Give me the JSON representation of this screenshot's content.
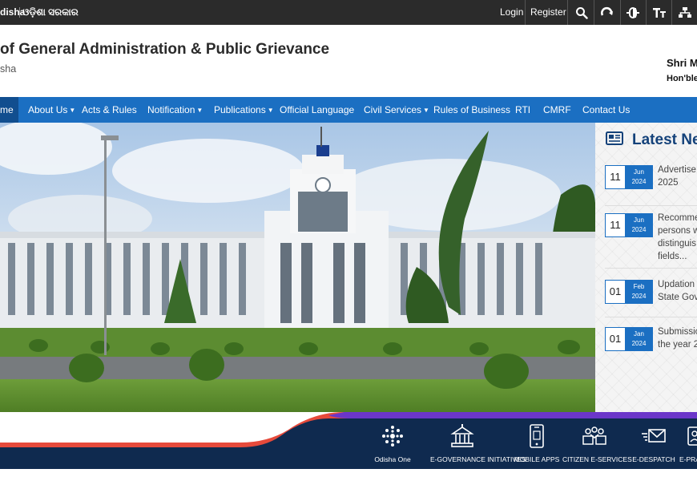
{
  "topbar": {
    "lang_en": "disha",
    "lang_or": "ଓଡ଼ିଶା ସରକାର",
    "login": "Login",
    "register": "Register",
    "tools": [
      "search-icon",
      "refresh-icon",
      "contrast-icon",
      "text-size-icon",
      "sitemap-icon"
    ]
  },
  "header": {
    "title": "of General Administration & Public Grievance",
    "subtitle": "sha",
    "person_name": "Shri M",
    "person_role": "Hon'ble"
  },
  "nav": {
    "items": [
      {
        "label": "me"
      },
      {
        "label": "About Us"
      },
      {
        "label": "Acts & Rules"
      },
      {
        "label": "Notification"
      },
      {
        "label": "Publications"
      },
      {
        "label": "Official Language"
      },
      {
        "label": "Civil Services"
      },
      {
        "label": "Rules of Business"
      },
      {
        "label": "RTI"
      },
      {
        "label": "CMRF"
      },
      {
        "label": "Contact Us"
      }
    ]
  },
  "news": {
    "title": "Latest Ne",
    "items": [
      {
        "day": "11",
        "month": "Jun",
        "year": "2024",
        "lines": [
          "Advertise",
          "2025"
        ]
      },
      {
        "day": "11",
        "month": "Jun",
        "year": "2024",
        "lines": [
          "Recomme",
          "persons w",
          "distinguis",
          "fields..."
        ]
      },
      {
        "day": "01",
        "month": "Feb",
        "year": "2024",
        "lines": [
          "Updation",
          "State Gove"
        ]
      },
      {
        "day": "01",
        "month": "Jan",
        "year": "2024",
        "lines": [
          "Submissio",
          "the year 2"
        ]
      }
    ]
  },
  "band": {
    "items": [
      {
        "label": "Odisha One",
        "icon": "odisha-one-icon"
      },
      {
        "label": "E-GOVERNANCE INITIATIVES",
        "icon": "government-building-icon"
      },
      {
        "label": "MOBILE APPS",
        "icon": "mobile-app-icon"
      },
      {
        "label": "CITIZEN E-SERVICES",
        "icon": "citizen-services-icon"
      },
      {
        "label": "E-DESPATCH",
        "icon": "e-despatch-icon"
      },
      {
        "label": "E-PRA",
        "icon": "e-pra-icon"
      }
    ]
  },
  "colors": {
    "topbar": "#2b2b2b",
    "nav": "#1b6fc2",
    "nav_active": "#114e8f",
    "news_title": "#14427a",
    "band_dark": "#0f2a4f",
    "band_accent": "#e64a3b"
  }
}
